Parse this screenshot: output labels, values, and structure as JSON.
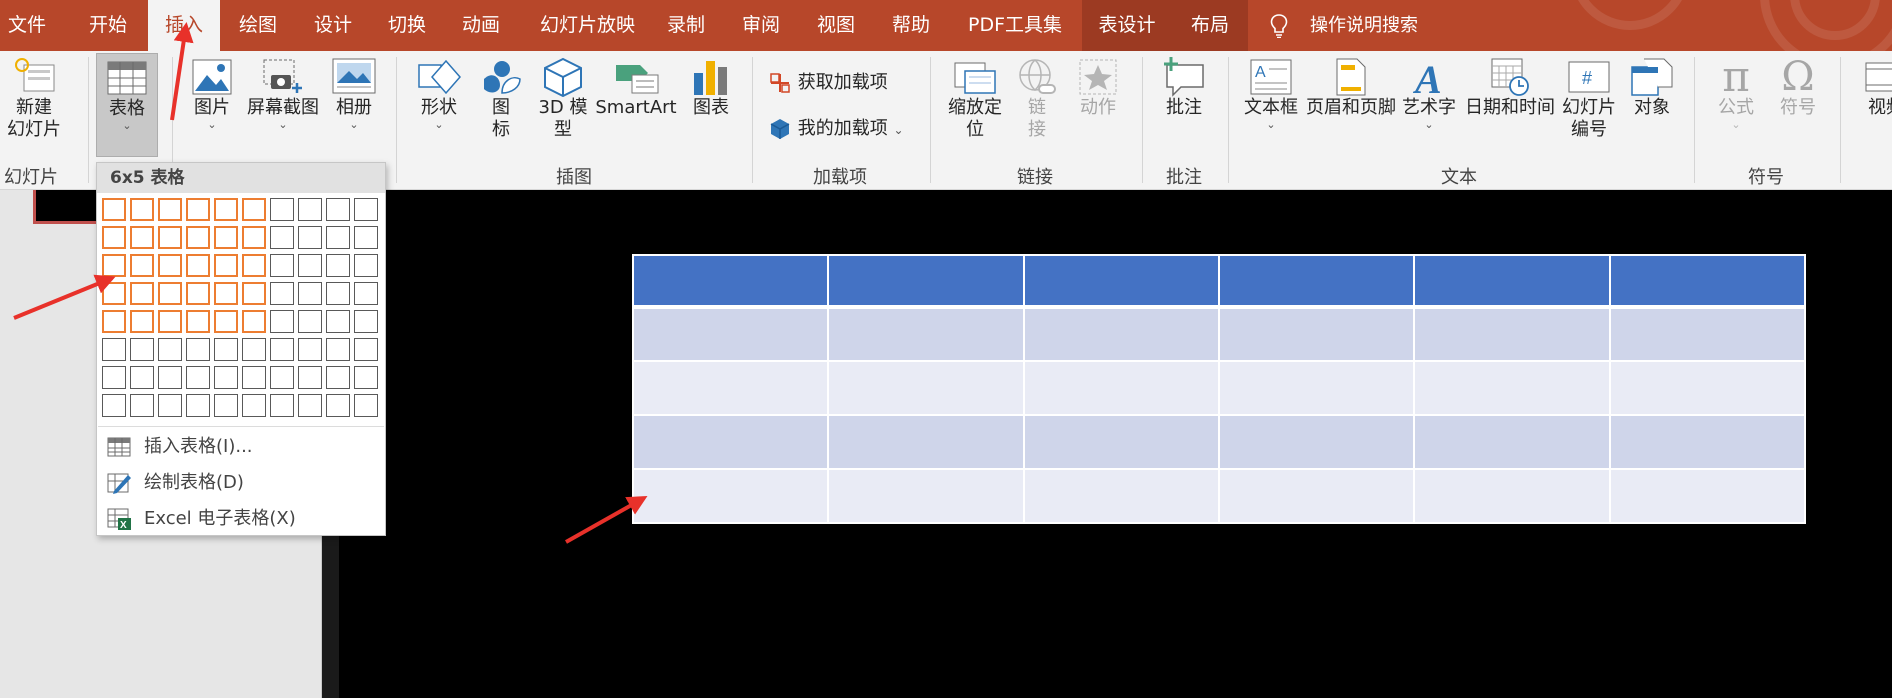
{
  "colors": {
    "accent": "#b7472a",
    "header_blue": "#4472c4",
    "band_1": "#cfd5ea",
    "band_2": "#e9ebf5",
    "highlight": "#ed7d31",
    "annotation_arrow": "#e8312a"
  },
  "tabs": [
    {
      "label": "文件"
    },
    {
      "label": "开始"
    },
    {
      "label": "插入"
    },
    {
      "label": "绘图"
    },
    {
      "label": "设计"
    },
    {
      "label": "切换"
    },
    {
      "label": "动画"
    },
    {
      "label": "幻灯片放映"
    },
    {
      "label": "录制"
    },
    {
      "label": "审阅"
    },
    {
      "label": "视图"
    },
    {
      "label": "帮助"
    },
    {
      "label": "PDF工具集"
    },
    {
      "label": "表设计"
    },
    {
      "label": "布局"
    }
  ],
  "search": {
    "label": "操作说明搜索",
    "icon": "lightbulb-icon"
  },
  "ribbon": {
    "slides": {
      "new_line1": "新建",
      "new_line2": "幻灯片",
      "group": "幻灯片"
    },
    "tables": {
      "table_label": "表格"
    },
    "images": {
      "picture": "图片",
      "screenshot": "屏幕截图",
      "album": "相册"
    },
    "illustrations": {
      "shapes": "形状",
      "icons_line1": "图",
      "icons_line2": "标",
      "model_line1": "3D 模",
      "model_line2": "型",
      "smartart": "SmartArt",
      "chart": "图表",
      "group": "插图"
    },
    "addins": {
      "get": "获取加载项",
      "mine": "我的加载项",
      "group": "加载项"
    },
    "links": {
      "zoom_line1": "缩放定",
      "zoom_line2": "位",
      "link_line1": "链",
      "link_line2": "接",
      "action": "动作",
      "group": "链接"
    },
    "comments": {
      "comment": "批注",
      "group": "批注"
    },
    "text": {
      "textbox": "文本框",
      "header_footer": "页眉和页脚",
      "wordart": "艺术字",
      "datetime": "日期和时间",
      "slide_num_line1": "幻灯片",
      "slide_num_line2": "编号",
      "object": "对象",
      "group": "文本"
    },
    "symbols": {
      "equation": "公式",
      "symbol": "符号",
      "group": "符号"
    },
    "media": {
      "video_partial": "视频"
    }
  },
  "dropdown": {
    "header": "6x5 表格",
    "grid": {
      "cols": 10,
      "rows": 8,
      "selected_cols": 6,
      "selected_rows": 5
    },
    "items": [
      {
        "label": "插入表格(I)...",
        "icon": "insert-table-icon"
      },
      {
        "label": "绘制表格(D)",
        "icon": "draw-table-icon"
      },
      {
        "label": "Excel 电子表格(X)",
        "icon": "excel-sheet-icon"
      }
    ]
  },
  "slide_table": {
    "cols": 6,
    "rows": 5
  }
}
